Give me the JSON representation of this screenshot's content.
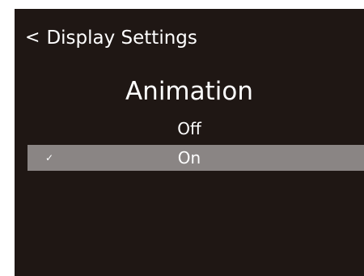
{
  "header": {
    "back_icon": "<",
    "title": "Display Settings"
  },
  "screen_title": "Animation",
  "options": [
    {
      "label": "Off",
      "selected": false
    },
    {
      "label": "On",
      "selected": true,
      "check_icon": "✓"
    }
  ],
  "colors": {
    "background": "#1f1714",
    "text": "#ffffff",
    "selected_row": "#8a8584"
  }
}
